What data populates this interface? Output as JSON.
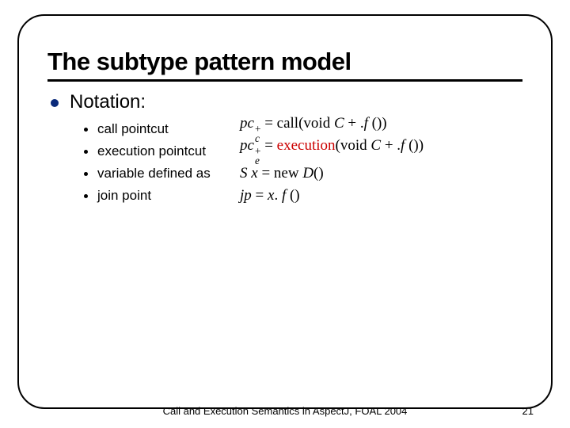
{
  "title": "The subtype pattern model",
  "section": {
    "label": "Notation:"
  },
  "items": [
    {
      "label": "call pointcut",
      "sym_base": "pc",
      "sym_sub": "c",
      "sym_sup": "+",
      "op": "call",
      "op_class": "",
      "rhs": "(void ",
      "rhs_i": "C",
      "rhs2": " + .",
      "rhs2_i": "f",
      "rhs3": " ())"
    },
    {
      "label": "execution pointcut",
      "sym_base": "pc",
      "sym_sub": "e",
      "sym_sup": "+",
      "op": "execution",
      "op_class": "exec",
      "rhs": "(void ",
      "rhs_i": "C",
      "rhs2": " + .",
      "rhs2_i": "f",
      "rhs3": " ())"
    },
    {
      "label": "variable defined as",
      "var_lhs": "S x",
      "var_mid": " = new ",
      "var_rhs": "D",
      "var_tail": "()"
    },
    {
      "label": "join point",
      "jp_lhs": "jp",
      "jp_mid": " = ",
      "jp_x": "x",
      "jp_dot": ". ",
      "jp_f": "f",
      "jp_tail": " ()"
    }
  ],
  "footer": "Call and Execution Semantics in AspectJ, FOAL 2004",
  "page_number": "21"
}
